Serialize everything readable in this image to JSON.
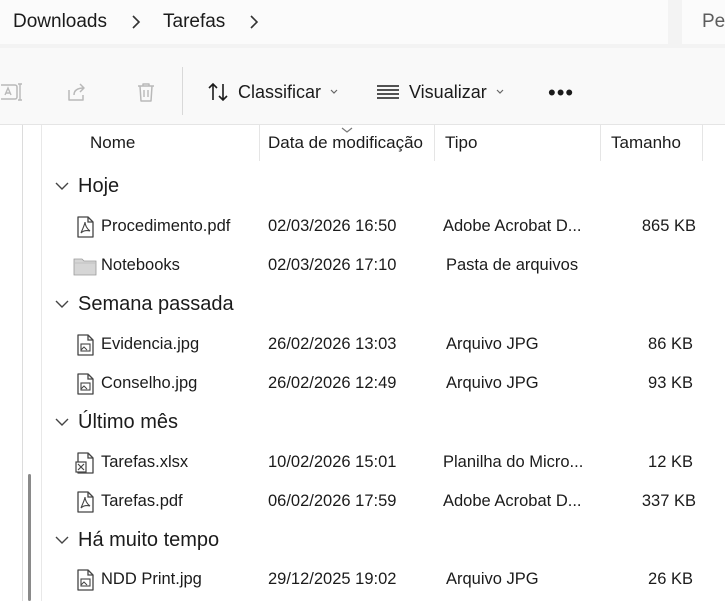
{
  "address": {
    "crumbs": [
      "Downloads",
      "Tarefas"
    ],
    "search_placeholder": "Pesquisar em Tarefas"
  },
  "toolbar": {
    "sort_label": "Classificar",
    "view_label": "Visualizar",
    "more_label": "•••",
    "icons": [
      "rename-icon",
      "share-icon",
      "delete-icon"
    ]
  },
  "columns": {
    "name": "Nome",
    "modified": "Data de modificação",
    "type": "Tipo",
    "size": "Tamanho"
  },
  "groups": [
    {
      "label": "Hoje"
    },
    {
      "label": "Semana passada"
    },
    {
      "label": "Último mês"
    },
    {
      "label": "Há muito tempo"
    }
  ],
  "files": [
    {
      "name": "Procedimento.pdf",
      "modified": "02/03/2026 16:50",
      "type": "Adobe Acrobat D...",
      "size": "865 KB",
      "icon": "pdf-file-icon"
    },
    {
      "name": "Notebooks",
      "modified": "02/03/2026 17:10",
      "type": "Pasta de arquivos",
      "size": "",
      "icon": "folder-icon"
    },
    {
      "name": "Evidencia.jpg",
      "modified": "26/02/2026 13:03",
      "type": "Arquivo JPG",
      "size": "86 KB",
      "icon": "image-file-icon"
    },
    {
      "name": "Conselho.jpg",
      "modified": "26/02/2026 12:49",
      "type": "Arquivo JPG",
      "size": "93 KB",
      "icon": "image-file-icon"
    },
    {
      "name": "Tarefas.xlsx",
      "modified": "10/02/2026 15:01",
      "type": "Planilha do Micro...",
      "size": "12 KB",
      "icon": "excel-file-icon"
    },
    {
      "name": "Tarefas.pdf",
      "modified": "06/02/2026 17:59",
      "type": "Adobe Acrobat D...",
      "size": "337 KB",
      "icon": "pdf-file-icon"
    },
    {
      "name": "NDD Print.jpg",
      "modified": "29/12/2025 19:02",
      "type": "Arquivo JPG",
      "size": "26 KB",
      "icon": "image-file-icon"
    }
  ]
}
